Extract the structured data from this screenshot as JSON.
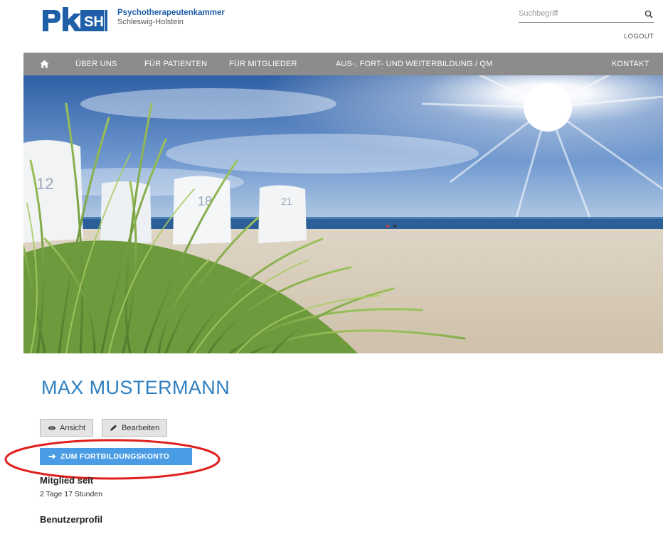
{
  "header": {
    "brand_mark": "pkSH",
    "org_name": "Psychotherapeutenkammer",
    "org_region": "Schleswig-Holstein",
    "search_placeholder": "Suchbegriff",
    "search_icon": "search-icon",
    "logout_label": "LOGOUT"
  },
  "nav": {
    "home_icon": "home-icon",
    "items": [
      {
        "label": "ÜBER UNS"
      },
      {
        "label": "FÜR PATIENTEN"
      },
      {
        "label": "FÜR MITGLIEDER"
      },
      {
        "label": "AUS-, FORT- UND WEITERBILDUNG / QM"
      },
      {
        "label": "KONTAKT"
      }
    ]
  },
  "hero": {
    "chair_numbers": [
      "12",
      "18",
      "21"
    ]
  },
  "profile": {
    "name": "MAX MUSTERMANN",
    "tabs": [
      {
        "label": "Ansicht",
        "icon": "eye-icon"
      },
      {
        "label": "Bearbeiten",
        "icon": "pencil-icon"
      }
    ],
    "fk_button": {
      "label": "ZUM FORTBILDUNGSKONTO",
      "icon": "arrow-right-icon"
    },
    "member_since_label": "Mitglied seit",
    "member_since_value": "2 Tage 17 Stunden",
    "user_profile_label": "Benutzerprofil"
  },
  "colors": {
    "brand_blue": "#1f5fa8",
    "title_blue": "#2e7fc1",
    "nav_gray": "#8c8c8c",
    "button_blue": "#4a9de5",
    "annotation_red": "#e0201c"
  }
}
